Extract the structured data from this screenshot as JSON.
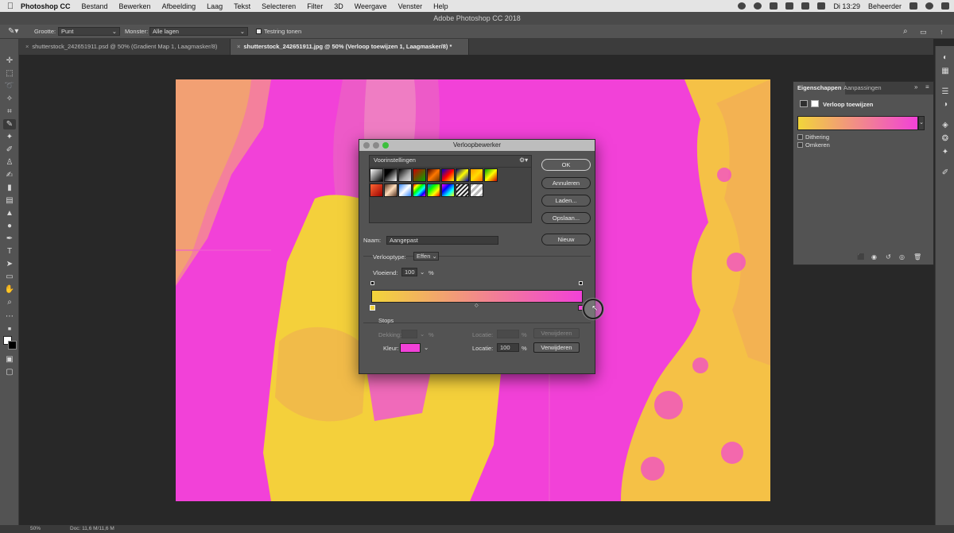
{
  "menubar": {
    "app": "Photoshop CC",
    "menus": [
      "Bestand",
      "Bewerken",
      "Afbeelding",
      "Laag",
      "Tekst",
      "Selecteren",
      "Filter",
      "3D",
      "Weergave",
      "Venster",
      "Help"
    ],
    "time": "Di 13:29",
    "user": "Beheerder"
  },
  "window": {
    "title": "Adobe Photoshop CC 2018"
  },
  "options": {
    "size_label": "Grootte:",
    "size_value": "Punt",
    "sample_label": "Monster:",
    "sample_value": "Alle lagen",
    "show_ring": "Testring tonen"
  },
  "tabs": [
    {
      "label": "shutterstock_242651911.psd @ 50% (Gradient Map 1, Laagmasker/8)"
    },
    {
      "label": "shutterstock_242651911.jpg @ 50% (Verloop toewijzen 1, Laagmasker/8) *"
    }
  ],
  "properties": {
    "tab1": "Eigenschappen",
    "tab2": "Aanpassingen",
    "layer_label": "Verloop toewijzen",
    "dithering": "Dithering",
    "reverse": "Omkeren"
  },
  "dialog": {
    "title": "Verloopbewerker",
    "presets_label": "Voorinstellingen",
    "ok": "OK",
    "cancel": "Annuleren",
    "load": "Laden...",
    "save": "Opslaan...",
    "name_label": "Naam:",
    "name_value": "Aangepast",
    "new": "Nieuw",
    "type_label": "Verlooptype:",
    "type_value": "Effen",
    "smooth_label": "Vloeiend:",
    "smooth_value": "100",
    "percent": "%",
    "stops_label": "Stops",
    "opacity_label": "Dekking:",
    "location_label": "Locatie:",
    "delete": "Verwijderen",
    "color_label": "Kleur:",
    "location_value": "100"
  },
  "status": {
    "zoom": "50%",
    "doc": "Doc: 11,6 M/11,6 M"
  },
  "colors": {
    "magenta": "#f241d8",
    "yellow": "#f2d53a"
  }
}
